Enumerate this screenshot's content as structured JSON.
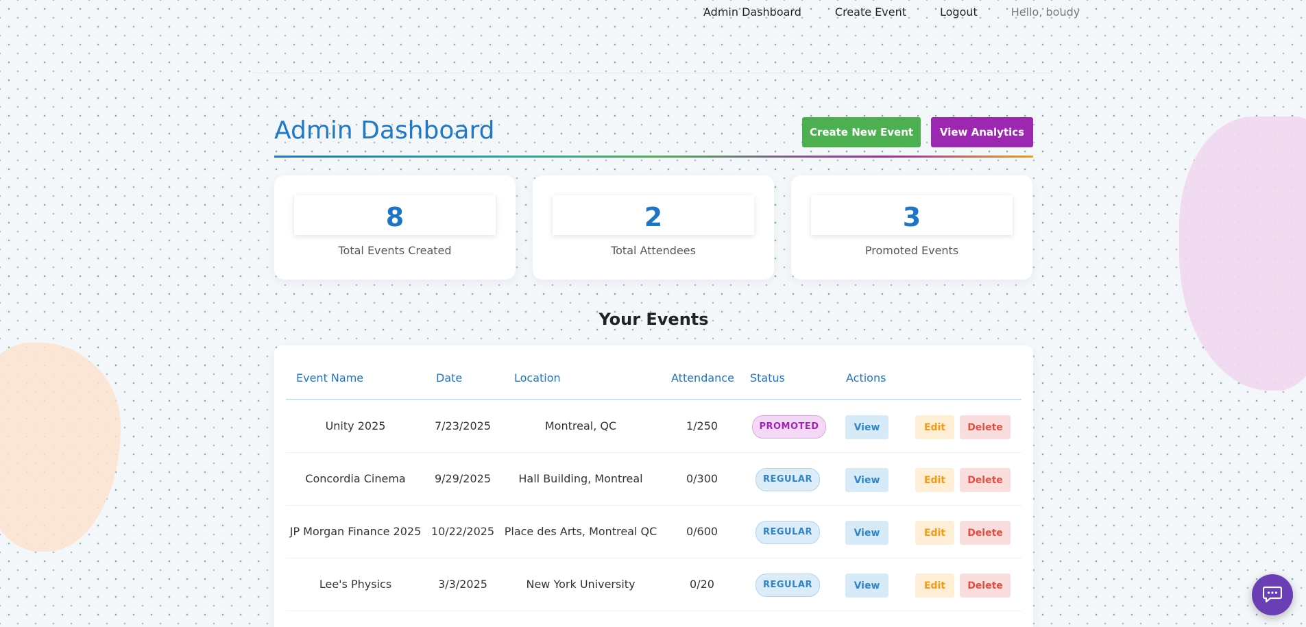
{
  "nav": {
    "links": [
      "Admin Dashboard",
      "Create Event",
      "Logout"
    ],
    "greeting": "Hello, boudy"
  },
  "header": {
    "title": "Admin Dashboard",
    "create_button": "Create New Event",
    "analytics_button": "View Analytics"
  },
  "stats": [
    {
      "value": "8",
      "label": "Total Events Created"
    },
    {
      "value": "2",
      "label": "Total Attendees"
    },
    {
      "value": "3",
      "label": "Promoted Events"
    }
  ],
  "events_section": {
    "title": "Your Events",
    "columns": [
      "Event Name",
      "Date",
      "Location",
      "Attendance",
      "Status",
      "Actions"
    ],
    "rows": [
      {
        "name": "Unity 2025",
        "date": "7/23/2025",
        "location": "Montreal, QC",
        "attendance": "1/250",
        "status": "PROMOTED"
      },
      {
        "name": "Concordia Cinema",
        "date": "9/29/2025",
        "location": "Hall Building, Montreal",
        "attendance": "0/300",
        "status": "REGULAR"
      },
      {
        "name": "JP Morgan Finance 2025",
        "date": "10/22/2025",
        "location": "Place des Arts, Montreal QC",
        "attendance": "0/600",
        "status": "REGULAR"
      },
      {
        "name": "Lee's Physics",
        "date": "3/3/2025",
        "location": "New York University",
        "attendance": "0/20",
        "status": "REGULAR"
      }
    ],
    "actions": {
      "view": "View",
      "edit": "Edit",
      "delete": "Delete"
    }
  },
  "colors": {
    "accent_blue": "#1e74c6",
    "create_green": "#4caf50",
    "analytics_purple": "#9c27b0",
    "chat_purple": "#6a3fb5"
  },
  "icons": {
    "chat": "chat-bubble-icon"
  }
}
